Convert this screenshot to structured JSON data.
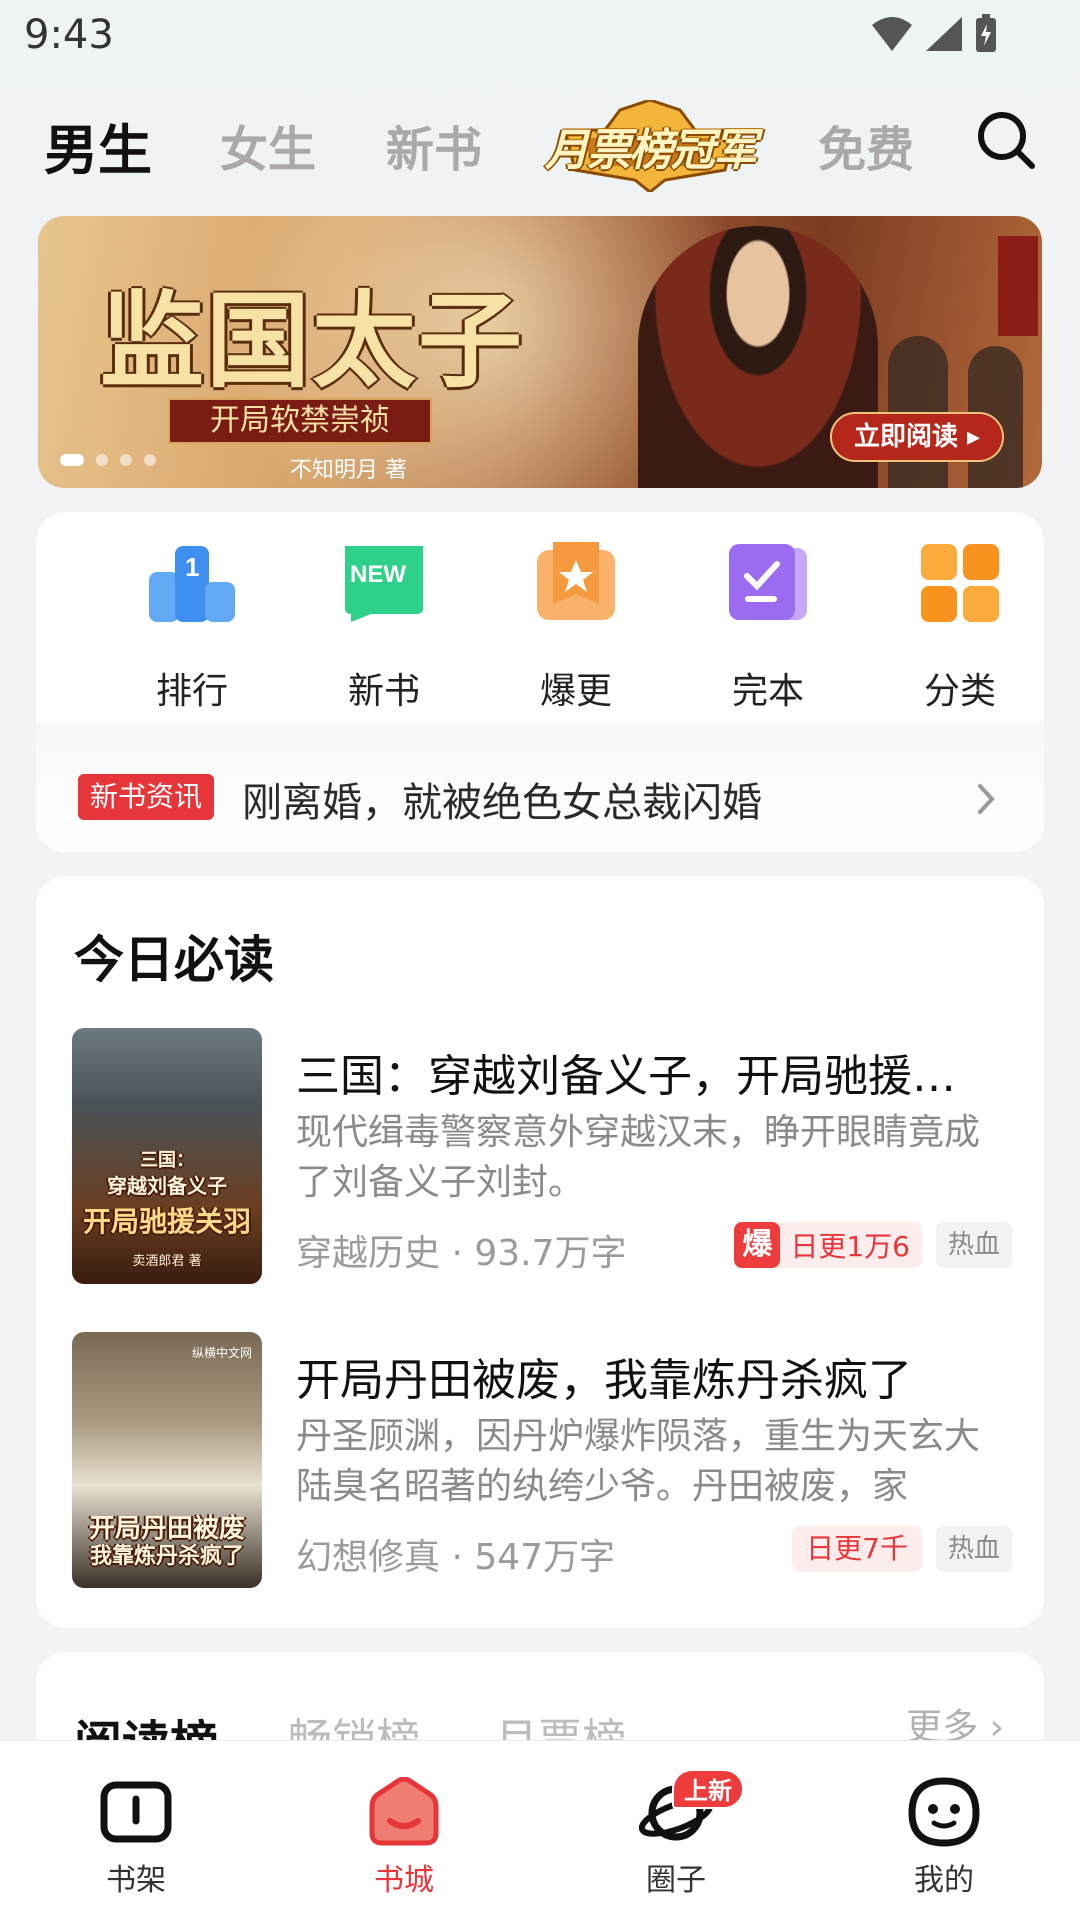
{
  "status_bar": {
    "time": "9:43"
  },
  "top_nav": {
    "tabs": [
      "男生",
      "女生",
      "新书",
      "免费"
    ],
    "badge_label": "月票榜冠军"
  },
  "banner": {
    "title": "监国太子",
    "subtitle": "开局软禁崇祯",
    "author": "不知明月 著",
    "button_label": "立即阅读 ▸",
    "slide_count": 4,
    "active_slide": 1
  },
  "quick_entries": [
    {
      "label": "排行",
      "icon": "ranking-icon",
      "color": "#3f8ff0"
    },
    {
      "label": "新书",
      "icon": "new-icon",
      "color": "#2fd08a"
    },
    {
      "label": "爆更",
      "icon": "star-book-icon",
      "color": "#f59a3f"
    },
    {
      "label": "完本",
      "icon": "finished-icon",
      "color": "#9b6cf0"
    },
    {
      "label": "分类",
      "icon": "category-icon",
      "color": "#f7931e"
    }
  ],
  "news": {
    "tag": "新书资讯",
    "text": "刚离婚，就被绝色女总裁闪婚"
  },
  "must_read": {
    "title": "今日必读",
    "books": [
      {
        "title": "三国：穿越刘备义子，开局驰援…",
        "description": "现代缉毒警察意外穿越汉末，睁开眼睛竟成了刘备义子刘封。",
        "meta": "穿越历史 · 93.7万字",
        "hot_badge": "爆",
        "update": "日更1万6",
        "genre_tag": "热血",
        "cover_line1": "三国：",
        "cover_line2": "穿越刘备义子",
        "cover_line3": "开局驰援关羽",
        "cover_author": "卖酒郎君 著"
      },
      {
        "title": "开局丹田被废，我靠炼丹杀疯了",
        "description": "丹圣顾渊，因丹炉爆炸陨落，重生为天玄大陆臭名昭著的纨绔少爷。丹田被废，家",
        "meta": "幻想修真 · 547万字",
        "update": "日更7千",
        "genre_tag": "热血",
        "cover_line1": "开局丹田被废",
        "cover_line2": "我靠炼丹杀疯了",
        "cover_publisher": "纵横中文网"
      }
    ]
  },
  "ranking": {
    "tabs": [
      "阅读榜",
      "畅销榜",
      "月票榜"
    ],
    "more_label": "更多 ›"
  },
  "bottom_nav": {
    "items": [
      {
        "label": "书架",
        "icon": "bookshelf-icon"
      },
      {
        "label": "书城",
        "icon": "bookstore-icon"
      },
      {
        "label": "圈子",
        "icon": "community-icon"
      },
      {
        "label": "我的",
        "icon": "profile-icon"
      }
    ],
    "active_index": 1,
    "badge": "上新"
  },
  "colors": {
    "accent": "#e7363a"
  }
}
